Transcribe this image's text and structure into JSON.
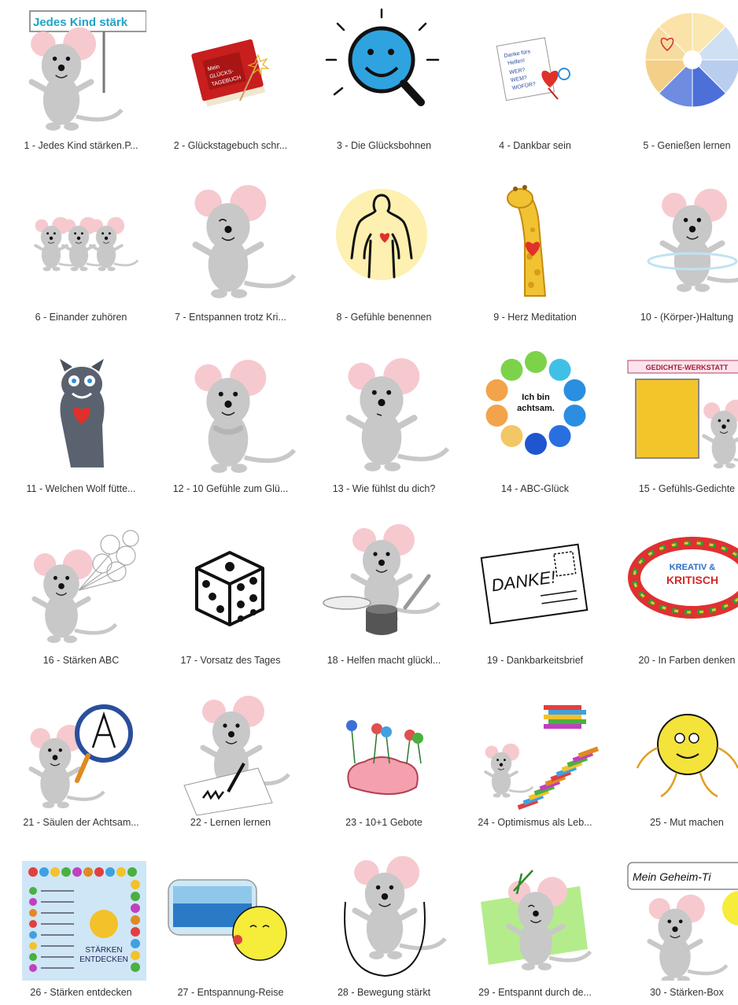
{
  "items": [
    {
      "label": "1 - Jedes Kind stärken.P...",
      "icon": "mouse-with-sign-icon",
      "sign": "Jedes Kind stärk"
    },
    {
      "label": "2 - Glückstagebuch schr...",
      "icon": "red-diary-icon",
      "book_text": "Mein GLÜCKS-TAGEBUCH"
    },
    {
      "label": "3 - Die Glücksbohnen",
      "icon": "smiling-magnifier-icon"
    },
    {
      "label": "4 - Dankbar sein",
      "icon": "thank-you-note-icon",
      "note_text": "Danke fürs Helfen! WER? WEM? WOFÜR?"
    },
    {
      "label": "5 - Genießen lernen",
      "icon": "senses-wheel-icon"
    },
    {
      "label": "6 - Einander zuhören",
      "icon": "three-mice-icon"
    },
    {
      "label": "7 - Entspannen trotz Kri...",
      "icon": "relaxed-mouse-icon"
    },
    {
      "label": "8 - Gefühle benennen",
      "icon": "body-heart-icon"
    },
    {
      "label": "9 - Herz Meditation",
      "icon": "giraffe-heart-icon"
    },
    {
      "label": "10 - (Körper-)Haltung",
      "icon": "spinning-mouse-icon"
    },
    {
      "label": "11 - Welchen Wolf fütte...",
      "icon": "wolf-heart-icon"
    },
    {
      "label": "12 - 10 Gefühle zum Glü...",
      "icon": "hugging-mouse-icon"
    },
    {
      "label": "13 - Wie fühlst du dich?",
      "icon": "thinking-mouse-icon"
    },
    {
      "label": "14 - ABC-Glück",
      "icon": "mindful-circle-icon",
      "center_text": "Ich bin achtsam."
    },
    {
      "label": "15 - Gefühls-Gedichte",
      "icon": "poem-workshop-icon",
      "banner": "GEDICHTE-WERKSTATT"
    },
    {
      "label": "16 - Stärken ABC",
      "icon": "mouse-balloons-icon"
    },
    {
      "label": "17 - Vorsatz des Tages",
      "icon": "dice-icon"
    },
    {
      "label": "18 - Helfen macht glückl...",
      "icon": "helping-mouse-icon"
    },
    {
      "label": "19 - Dankbarkeitsbrief",
      "icon": "thank-you-postcard-icon",
      "card_text": "DANKE!"
    },
    {
      "label": "20 - In Farben denken",
      "icon": "board-game-icon",
      "board_text": "KREATIV & KRITISCH"
    },
    {
      "label": "21 - Säulen der Achtsam...",
      "icon": "mouse-magnifier-icon"
    },
    {
      "label": "22 - Lernen lernen",
      "icon": "writing-mouse-icon"
    },
    {
      "label": "23 - 10+1 Gebote",
      "icon": "flowering-brain-icon"
    },
    {
      "label": "24 - Optimismus als Leb...",
      "icon": "book-stairs-icon"
    },
    {
      "label": "25 - Mut machen",
      "icon": "jumping-sun-icon"
    },
    {
      "label": "26 - Stärken entdecken",
      "icon": "strengths-board-icon",
      "board_text": "STÄRKEN ENTDECKEN"
    },
    {
      "label": "27 - Entspannung-Reise",
      "icon": "dreaming-sun-icon"
    },
    {
      "label": "28 - Bewegung stärkt",
      "icon": "jumping-rope-mouse-icon"
    },
    {
      "label": "29 - Entspannt durch de...",
      "icon": "resting-mouse-icon"
    },
    {
      "label": "30 - Stärken-Box",
      "icon": "secret-tip-mouse-icon",
      "sign": "Mein Geheim-Ti"
    }
  ]
}
